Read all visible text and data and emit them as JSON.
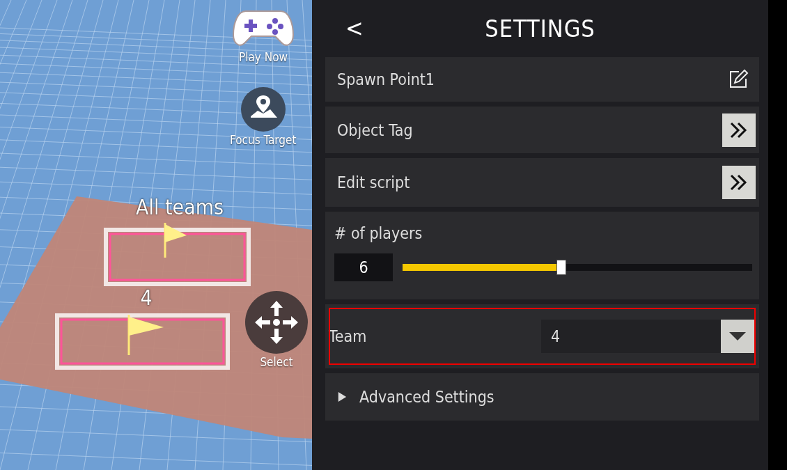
{
  "scene": {
    "objects": [
      {
        "label": "All teams"
      },
      {
        "label": "4"
      }
    ],
    "tools": [
      {
        "kind": "gamepad",
        "label": "Play Now"
      },
      {
        "kind": "focus",
        "label": "Focus Target"
      },
      {
        "kind": "move",
        "label": "Select"
      }
    ]
  },
  "settings": {
    "title": "SETTINGS",
    "back": "<",
    "rows": [
      {
        "kind": "name",
        "label": "Spawn Point1"
      },
      {
        "kind": "link",
        "label": "Object Tag"
      },
      {
        "kind": "link",
        "label": "Edit script"
      },
      {
        "kind": "slider",
        "label": "# of players",
        "value": "6",
        "level": 0.455
      },
      {
        "kind": "dropdown",
        "label": "Team",
        "value": "4",
        "highlighted": true
      },
      {
        "kind": "section",
        "label": "Advanced Settings",
        "expanded": false
      }
    ]
  }
}
